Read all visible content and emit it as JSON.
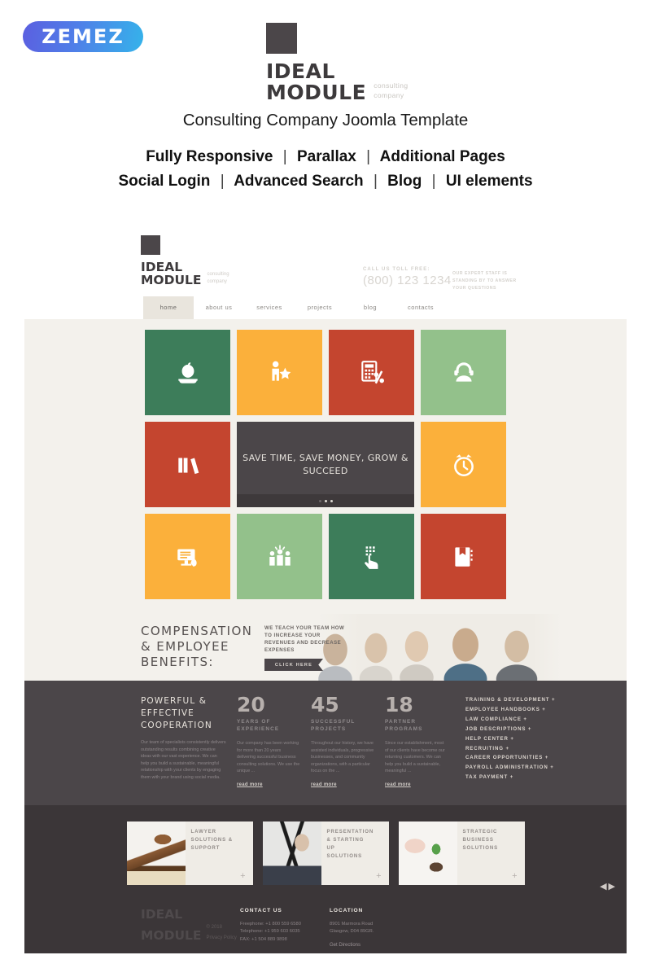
{
  "promo": {
    "vendor_logo": "ZEMEZ",
    "brand": {
      "line1": "IDEAL",
      "line2": "MODULE",
      "tagline1": "consulting",
      "tagline2": "company"
    },
    "title": "Consulting Company Joomla Template",
    "features_row1": [
      "Fully Responsive",
      "Parallax",
      "Additional Pages"
    ],
    "features_row2": [
      "Social Login",
      "Advanced Search",
      "Blog",
      "UI elements"
    ],
    "separator": "|"
  },
  "site": {
    "brand": {
      "line1": "IDEAL",
      "line2": "MODULE",
      "tagline1": "consulting",
      "tagline2": "company"
    },
    "phone": {
      "label": "CALL US TOLL FREE:",
      "number": "(800) 123 1234",
      "note": "OUR EXPERT STAFF IS STANDING BY TO ANSWER YOUR QUESTIONS"
    },
    "nav": [
      {
        "label": "home",
        "active": true
      },
      {
        "label": "about us",
        "active": false
      },
      {
        "label": "services",
        "active": false
      },
      {
        "label": "projects",
        "active": false
      },
      {
        "label": "blog",
        "active": false
      },
      {
        "label": "contacts",
        "active": false
      }
    ],
    "tiles": {
      "row1": [
        {
          "icon": "apple-book-icon",
          "color": "#3d7d5a"
        },
        {
          "icon": "person-star-icon",
          "color": "#fbb03b"
        },
        {
          "icon": "calculator-percent-icon",
          "color": "#c4452f"
        },
        {
          "icon": "headset-support-icon",
          "color": "#93c18b"
        }
      ],
      "row2_left": {
        "icon": "books-icon",
        "color": "#c4452f"
      },
      "slider": {
        "caption": "SAVE TIME, SAVE MONEY, GROW & SUCCEED",
        "dots": 3,
        "active_dot": 2,
        "color": "#4b4649"
      },
      "row2_right": {
        "icon": "alarm-clock-icon",
        "color": "#fbb03b"
      },
      "row3": [
        {
          "icon": "presentation-monitor-icon",
          "color": "#fbb03b"
        },
        {
          "icon": "team-group-icon",
          "color": "#93c18b"
        },
        {
          "icon": "hand-touch-icon",
          "color": "#3d7d5a"
        },
        {
          "icon": "notebook-icon",
          "color": "#c4452f"
        }
      ]
    },
    "compensation": {
      "title_l1": "COMPENSATION",
      "title_l2": "& EMPLOYEE",
      "title_l3": "BENEFITS:",
      "subtitle": "WE TEACH YOUR TEAM HOW TO INCREASE YOUR REVENUES AND DECREASE EXPENSES",
      "button": "CLICK HERE"
    },
    "stats_section": {
      "heading_l1": "POWERFUL &",
      "heading_l2": "EFFECTIVE",
      "heading_l3": "COOPERATION",
      "heading_body": "Our team of specialists consistently delivers outstanding results combining creative ideas with our vast experience. We can help you build a sustainable, meaningful relationship with your clients by engaging them with your brand using social media.",
      "stats": [
        {
          "number": "20",
          "label_l1": "YEARS OF",
          "label_l2": "EXPERIENCE",
          "text": "Our company has been working for more than 20 years delivering successful business consulting solutions. We use the unique ...",
          "link": "read more"
        },
        {
          "number": "45",
          "label_l1": "SUCCESSFUL",
          "label_l2": "PROJECTS",
          "text": "Throughout our history, we have assisted individuals, progressive businesses, and community organizations, with a particular focus on the ...",
          "link": "read more"
        },
        {
          "number": "18",
          "label_l1": "PARTNER",
          "label_l2": "PROGRAMS",
          "text": "Since our establishment, most of our clients have become our returning customers. We can help you build a sustainable, meaningful ...",
          "link": "read more"
        }
      ],
      "services": [
        "TRAINING & DEVELOPMENT +",
        "EMPLOYEE HANDBOOKS +",
        "LAW COMPLIANCE +",
        "JOB DESCRIPTIONS +",
        "HELP CENTER +",
        "RECRUITING +",
        "CAREER OPPORTUNITIES +",
        "PAYROLL ADMINISTRATION +",
        "TAX PAYMENT +"
      ]
    },
    "carousel": {
      "cards": [
        {
          "title_l1": "LAWYER",
          "title_l2": "SOLUTIONS &",
          "title_l3": "SUPPORT",
          "title_l4": "",
          "image": "gavel-photo",
          "plus": "+"
        },
        {
          "title_l1": "PRESENTATION",
          "title_l2": "& STARTING",
          "title_l3": "UP",
          "title_l4": "SOLUTIONS",
          "image": "businessman-chart-photo",
          "plus": "+"
        },
        {
          "title_l1": "STRATEGIC",
          "title_l2": "BUSINESS",
          "title_l3": "SOLUTIONS",
          "title_l4": "",
          "image": "hand-plant-photo",
          "plus": "+"
        }
      ],
      "prev_arrow": "◀",
      "next_arrow": "▶"
    },
    "footer": {
      "brand_l1": "IDEAL",
      "brand_l2": "MODULE",
      "copyright": "© 2018",
      "privacy": "Privacy Policy",
      "contact_heading": "CONTACT US",
      "contact_lines": [
        "Freephone: +1 800 559 6580",
        "Telephone: +1 959 603 6035",
        "FAX: +1 504 889 9898"
      ],
      "location_heading": "LOCATION",
      "location_lines": [
        "8901 Marmora Road",
        "Glasgow, D04 89GR."
      ],
      "directions_link": "Get Directions"
    }
  },
  "colors": {
    "dark": "#4b4649",
    "darker": "#3b3638",
    "cream": "#f3f1ec",
    "green": "#3d7d5a",
    "light_green": "#93c18b",
    "orange": "#fbb03b",
    "red": "#c4452f"
  }
}
